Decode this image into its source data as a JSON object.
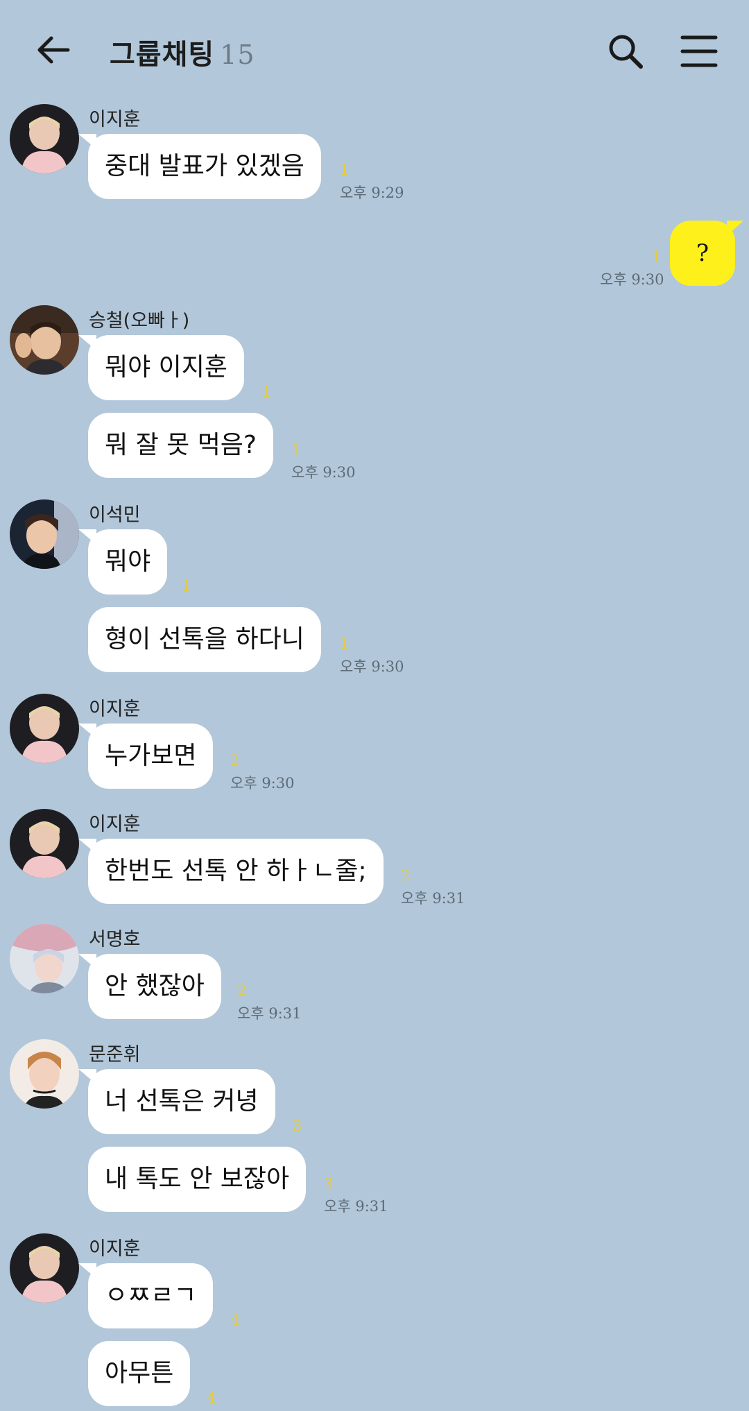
{
  "header": {
    "title": "그룹채팅",
    "member_count": "15",
    "back_icon": "arrow-left-icon",
    "search_icon": "search-icon",
    "menu_icon": "hamburger-menu-icon"
  },
  "colors": {
    "background": "#b2c7d9",
    "my_bubble": "#fef01b",
    "other_bubble": "#ffffff",
    "unread": "#e3cb3e"
  },
  "messages": [
    {
      "sender": "이지훈",
      "text": "중대 발표가 있겠음",
      "unread": "1",
      "time": "오후 9:29"
    },
    {
      "sender": "me",
      "text": "?",
      "unread": "1",
      "time": "오후 9:30"
    },
    {
      "sender": "승철(오빠ㅏ)",
      "text": "뭐야 이지훈",
      "unread": "1"
    },
    {
      "sender": "승철(오빠ㅏ)",
      "text": "뭐 잘 못 먹음?",
      "unread": "1",
      "time": "오후 9:30"
    },
    {
      "sender": "이석민",
      "text": "뭐야",
      "unread": "1"
    },
    {
      "sender": "이석민",
      "text": "형이 선톡을 하다니",
      "unread": "1",
      "time": "오후 9:30"
    },
    {
      "sender": "이지훈",
      "text": "누가보면",
      "unread": "2",
      "time": "오후 9:30"
    },
    {
      "sender": "이지훈",
      "text": "한번도 선톡 안 하ㅏㄴ줄;",
      "unread": "2",
      "time": "오후 9:31"
    },
    {
      "sender": "서명호",
      "text": "안 했잖아",
      "unread": "2",
      "time": "오후 9:31"
    },
    {
      "sender": "문준휘",
      "text": "너 선톡은 커녕",
      "unread": "3"
    },
    {
      "sender": "문준휘",
      "text": "내 톡도 안 보잖아",
      "unread": "3",
      "time": "오후 9:31"
    },
    {
      "sender": "이지훈",
      "text": "ㅇㅉㄹㄱ",
      "unread": "4"
    },
    {
      "sender": "이지훈",
      "text": "아무튼",
      "unread": "4"
    }
  ]
}
